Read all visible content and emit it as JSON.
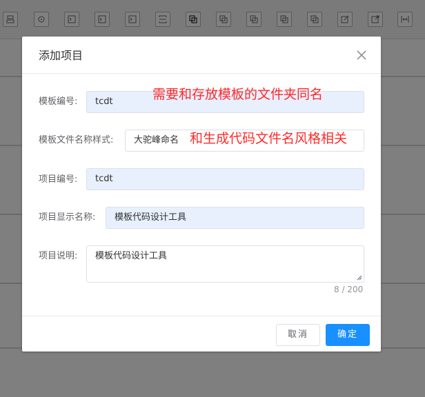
{
  "toolbar": {
    "icons": [
      "org-icon",
      "crosshair-icon",
      "terminal-icon",
      "terminal-icon",
      "terminal-icon",
      "split-icon",
      "copy-icon",
      "copy-icon",
      "copy-icon",
      "copy-icon",
      "copy-icon",
      "edit-icon",
      "export-icon",
      "resize-icon"
    ]
  },
  "dialog": {
    "title": "添加项目",
    "fields": {
      "template_code": {
        "label": "模板编号:",
        "value": "tcdt"
      },
      "template_file_name_style": {
        "label": "模板文件名称样式:",
        "value": "大驼峰命名"
      },
      "project_code": {
        "label": "项目编号:",
        "value": "tcdt"
      },
      "project_display_name": {
        "label": "项目显示名称:",
        "value": "模板代码设计工具"
      },
      "project_description": {
        "label": "项目说明:",
        "value": "模板代码设计工具",
        "counter": "8 / 200"
      }
    },
    "annotations": {
      "template_code_note": "需要和存放模板的文件夹同名",
      "file_style_note": "和生成代码文件名风格相关"
    },
    "buttons": {
      "cancel": "取消",
      "confirm": "确定"
    }
  },
  "colors": {
    "primary": "#1890ff",
    "annotation": "#ff2a2a",
    "autofill_bg": "#e8f0fe"
  }
}
